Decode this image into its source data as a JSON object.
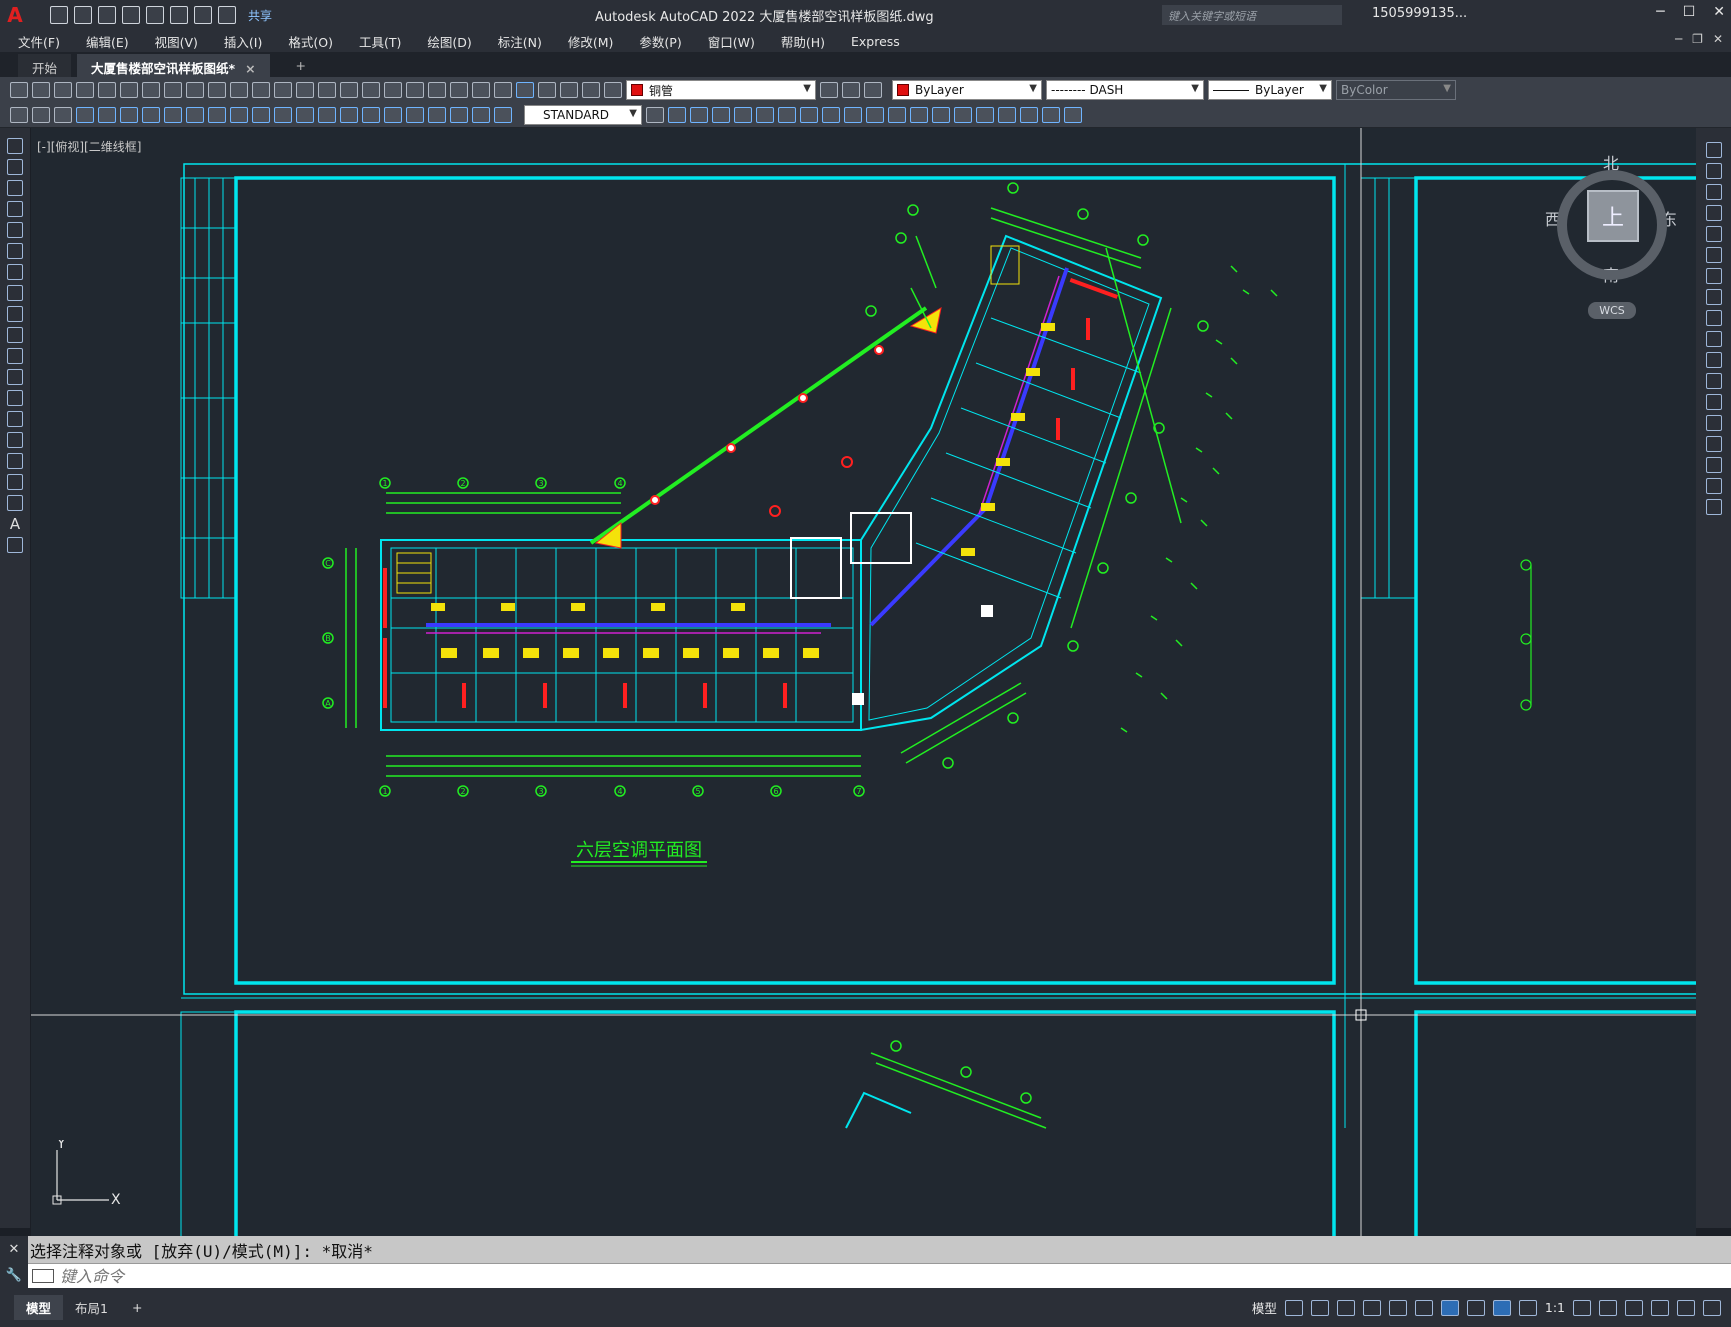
{
  "app": {
    "window_title": "Autodesk AutoCAD 2022    大厦售楼部空讯样板图纸.dwg",
    "share_label": "共享",
    "search_placeholder": "键入关键字或短语",
    "user_label": "1505999135...",
    "logo_letter": "A"
  },
  "menu": {
    "items": [
      "文件(F)",
      "编辑(E)",
      "视图(V)",
      "插入(I)",
      "格式(O)",
      "工具(T)",
      "绘图(D)",
      "标注(N)",
      "修改(M)",
      "参数(P)",
      "窗口(W)",
      "帮助(H)",
      "Express"
    ]
  },
  "tabs": {
    "start": "开始",
    "active": "大厦售楼部空讯样板图纸*",
    "close": "×",
    "add": "+"
  },
  "properties": {
    "layer": "铜管",
    "color": "ByLayer",
    "linetype": "-------- DASH",
    "lineweight": "ByLayer",
    "plotstyle": "ByColor",
    "textstyle": "STANDARD",
    "color_swatch": "#e01010"
  },
  "viewport": {
    "label": "[-][俯视][二维线框]"
  },
  "viewcube": {
    "north": "北",
    "south": "南",
    "east": "东",
    "west": "西",
    "face": "上",
    "wcs": "WCS"
  },
  "drawing": {
    "plan_title": "六层空调平面图",
    "grid_top": [
      "1",
      "2",
      "3",
      "4"
    ],
    "grid_bottom": [
      "1",
      "2",
      "3",
      "4",
      "5",
      "6",
      "7"
    ],
    "grid_left": [
      "C",
      "B",
      "A"
    ],
    "accent_cyan": "#00e5ee",
    "accent_green": "#22ee22",
    "duct_blue": "#3a3aff",
    "pipe_magenta": "#d020d0"
  },
  "ucs": {
    "y": "Y",
    "x": "X"
  },
  "command": {
    "history": "选择注释对象或 [放弃(U)/模式(M)]: *取消*",
    "placeholder": "键入命令"
  },
  "status": {
    "model_tab": "模型",
    "layout_tab": "布局1",
    "add_tab": "+",
    "model_label": "模型",
    "scale": "1:1"
  }
}
